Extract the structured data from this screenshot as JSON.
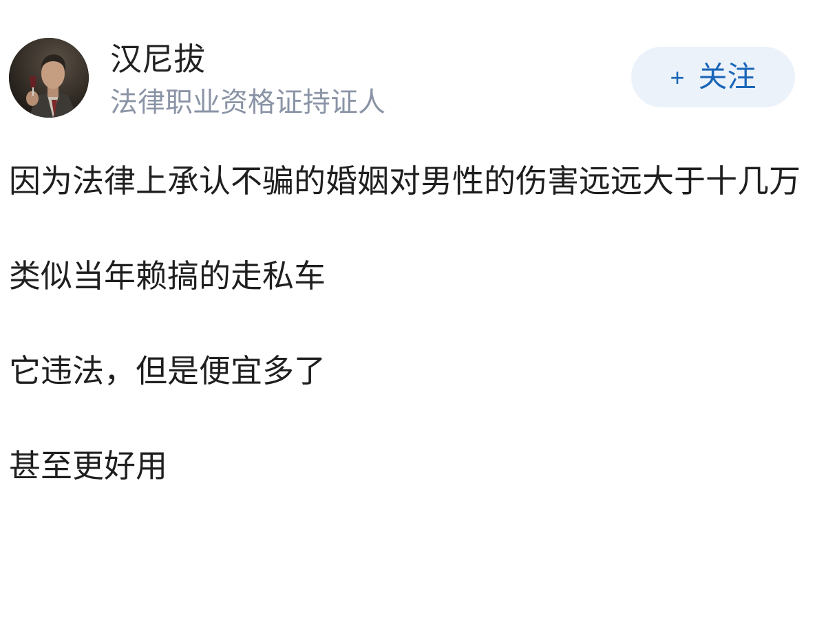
{
  "author": {
    "name": "汉尼拔",
    "title": "法律职业资格证持证人",
    "avatar_icon": "person-portrait-avatar"
  },
  "follow": {
    "plus": "+",
    "label": "关注"
  },
  "post": {
    "paragraphs": [
      "因为法律上承认不骗的婚姻对男性的伤害远远大于十几万",
      "类似当年赖搞的走私车",
      "它违法，但是便宜多了",
      "甚至更好用"
    ]
  },
  "colors": {
    "accent": "#1a66b8",
    "follow_bg": "#ebf2fa",
    "subtitle": "#8a94a6",
    "text": "#1f1f1f"
  }
}
